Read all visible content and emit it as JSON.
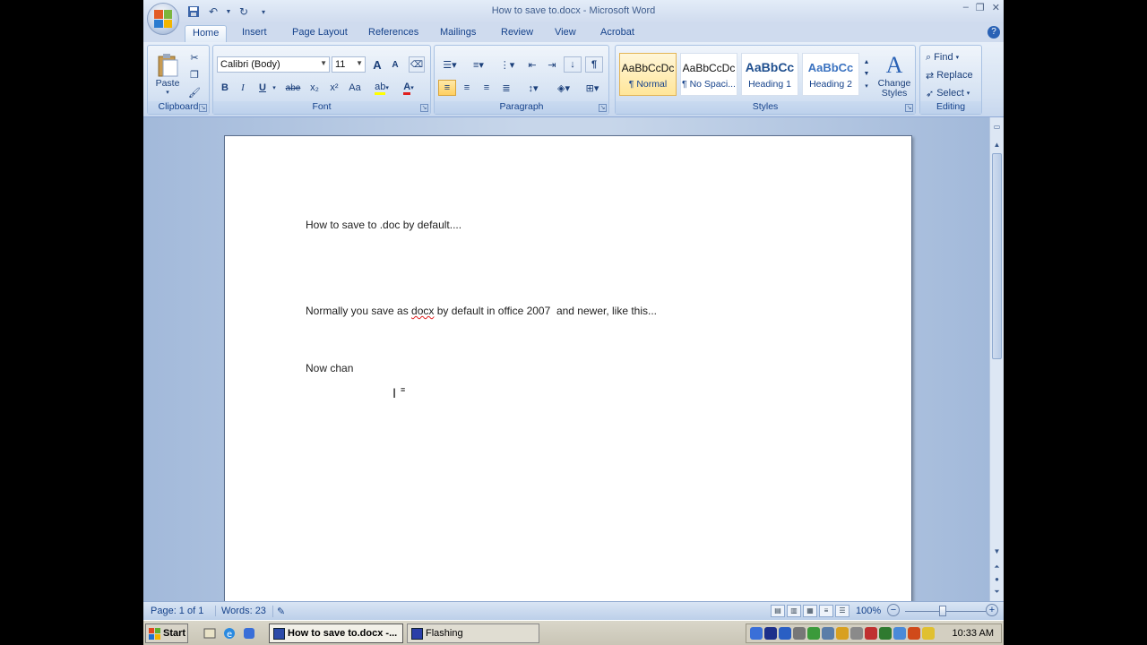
{
  "window": {
    "title": "How to save to.docx - Microsoft Word"
  },
  "tabs": [
    {
      "label": "Home",
      "active": true
    },
    {
      "label": "Insert"
    },
    {
      "label": "Page Layout"
    },
    {
      "label": "References"
    },
    {
      "label": "Mailings"
    },
    {
      "label": "Review"
    },
    {
      "label": "View"
    },
    {
      "label": "Acrobat"
    }
  ],
  "ribbon": {
    "clipboard": {
      "label": "Clipboard",
      "paste_label": "Paste"
    },
    "font": {
      "label": "Font",
      "font_name": "Calibri (Body)",
      "font_size": "11",
      "bold": "B",
      "italic": "I",
      "underline": "U",
      "strike": "abe",
      "subscript": "x₂",
      "superscript": "x²",
      "change_case": "Aa",
      "grow": "A",
      "shrink": "A"
    },
    "paragraph": {
      "label": "Paragraph"
    },
    "styles": {
      "label": "Styles",
      "change_styles": "Change Styles",
      "items": [
        {
          "sample": "AaBbCcDc",
          "name": "¶ Normal",
          "selected": true
        },
        {
          "sample": "AaBbCcDc",
          "name": "¶ No Spaci..."
        },
        {
          "sample": "AaBbCc",
          "name": "Heading 1"
        },
        {
          "sample": "AaBbCc",
          "name": "Heading 2"
        }
      ]
    },
    "editing": {
      "label": "Editing",
      "find": "Find",
      "replace": "Replace",
      "select": "Select"
    }
  },
  "document": {
    "line1": "How to save to .doc by default....",
    "line2_pre": "Normally you save as ",
    "line2_word": "docx",
    "line2_post": " by default in office 2007  and newer, like this...",
    "line3": "Now chan"
  },
  "statusbar": {
    "page": "Page: 1 of 1",
    "words": "Words: 23",
    "zoom": "100%"
  },
  "taskbar": {
    "start": "Start",
    "tasks": [
      {
        "label": "How to save to.docx -...",
        "active": true
      },
      {
        "label": "Flashing"
      }
    ],
    "clock": "10:33 AM"
  },
  "colors": {
    "accent": "#15428b",
    "ribbon": "#d4e1f2",
    "misspell": "#e02020"
  }
}
